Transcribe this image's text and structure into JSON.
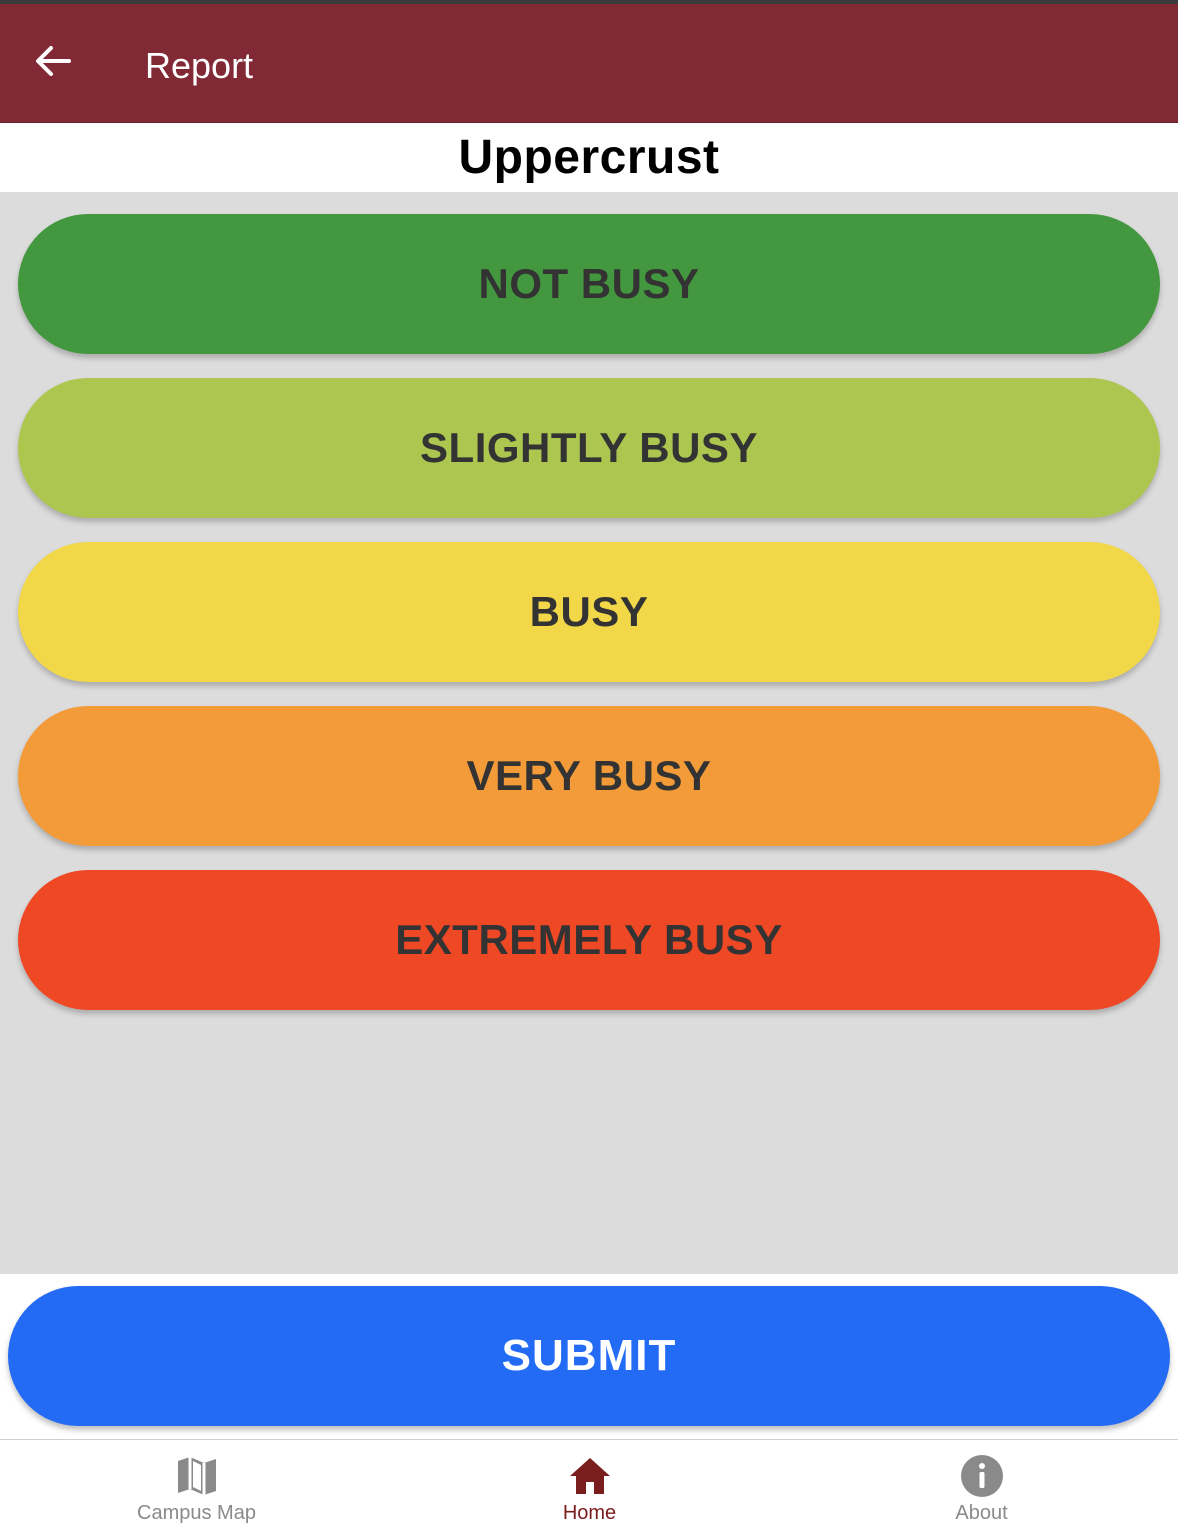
{
  "header": {
    "title": "Report",
    "background": "#812a35",
    "back_icon": "arrow-left-icon"
  },
  "place": {
    "name": "Uppercrust"
  },
  "options": [
    {
      "label": "NOT BUSY",
      "color": "#43973f"
    },
    {
      "label": "SLIGHTLY BUSY",
      "color": "#adc64f"
    },
    {
      "label": "BUSY",
      "color": "#f2d849"
    },
    {
      "label": "VERY BUSY",
      "color": "#f29b38"
    },
    {
      "label": "EXTREMELY BUSY",
      "color": "#ee4825"
    }
  ],
  "submit": {
    "label": "SUBMIT",
    "color": "#236af5"
  },
  "tabbar": {
    "items": [
      {
        "label": "Campus Map",
        "icon": "map-icon",
        "active": false
      },
      {
        "label": "Home",
        "icon": "home-icon",
        "active": true
      },
      {
        "label": "About",
        "icon": "info-icon",
        "active": false
      }
    ]
  }
}
